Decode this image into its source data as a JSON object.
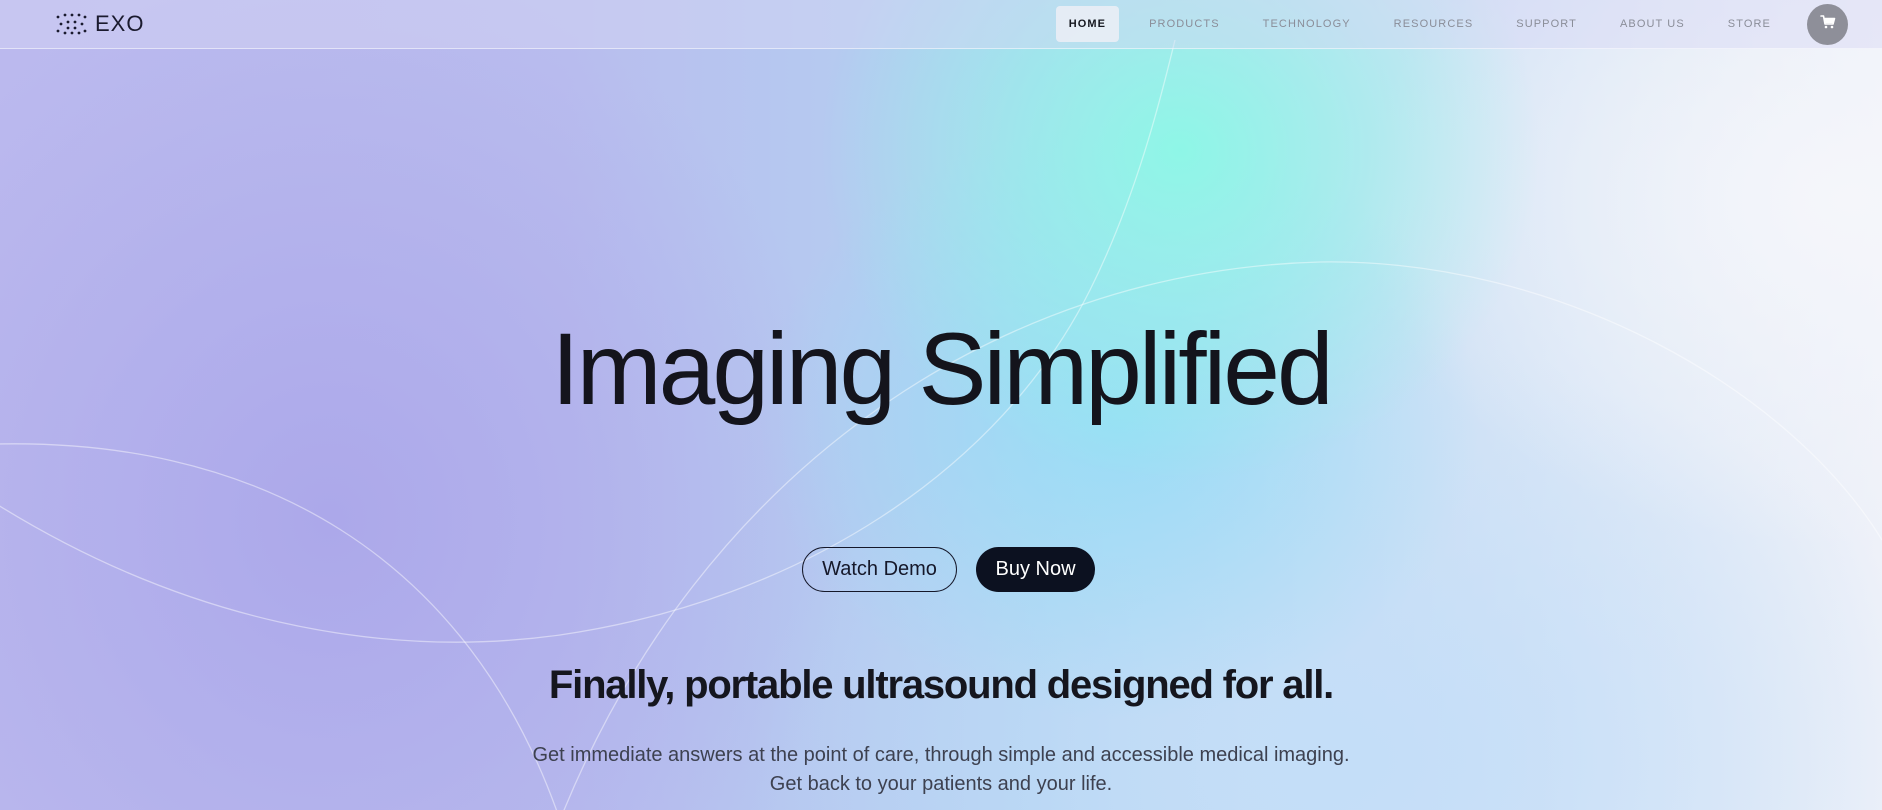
{
  "brand": {
    "name": "EXO",
    "logo_icon": "dot-grid-logo-icon"
  },
  "nav": {
    "items": [
      {
        "label": "HOME",
        "active": true
      },
      {
        "label": "PRODUCTS",
        "active": false
      },
      {
        "label": "TECHNOLOGY",
        "active": false
      },
      {
        "label": "RESOURCES",
        "active": false
      },
      {
        "label": "SUPPORT",
        "active": false
      },
      {
        "label": "ABOUT US",
        "active": false
      },
      {
        "label": "STORE",
        "active": false
      }
    ],
    "cart_icon": "shopping-cart-icon"
  },
  "hero": {
    "title": "Imaging Simplified",
    "watch_demo_label": "Watch Demo",
    "buy_now_label": "Buy Now",
    "subtitle": "Finally, portable ultrasound designed for all.",
    "description_line1": "Get immediate answers at the point of care, through simple and accessible medical imaging.",
    "description_line2": "Get back to your patients and your life."
  },
  "colors": {
    "text_dark": "#14141c",
    "button_dark": "#0c1120",
    "nav_inactive": "#8a8d98",
    "cart_bg": "#8e8f99",
    "gradient_mint": "#8cf8e6",
    "gradient_lavender": "#aca8ea"
  }
}
